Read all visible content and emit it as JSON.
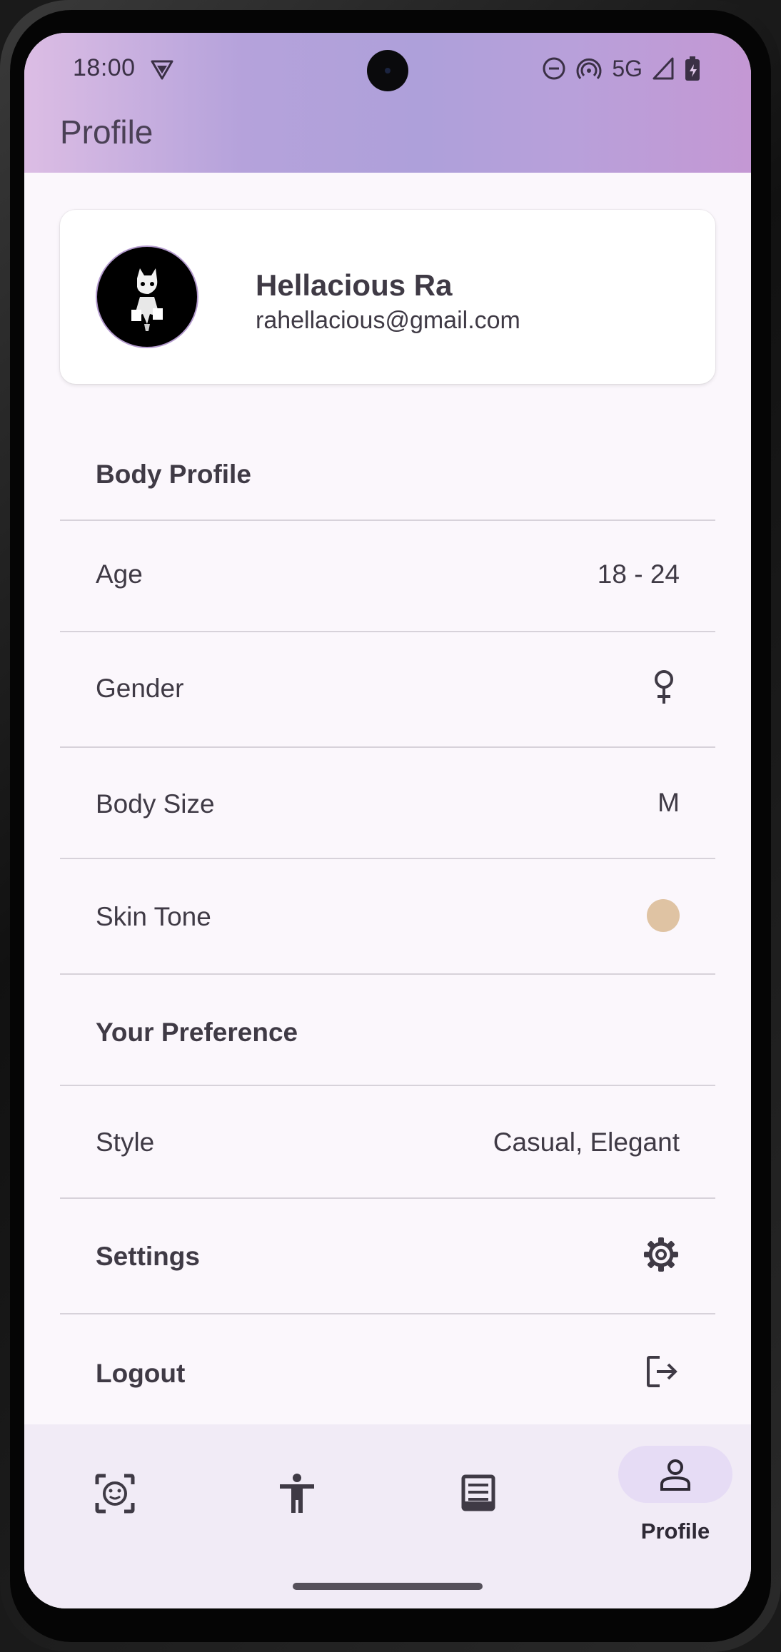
{
  "status_bar": {
    "time": "18:00",
    "network": "5G",
    "icons": [
      "vpn-icon",
      "dnd-icon",
      "hotspot-icon",
      "signal-icon",
      "battery-icon"
    ]
  },
  "header": {
    "title": "Profile"
  },
  "user": {
    "name": "Hellacious Ra",
    "email": "rahellacious@gmail.com"
  },
  "sections": {
    "body_profile": "Body Profile",
    "your_preference": "Your Preference"
  },
  "rows": {
    "age": {
      "label": "Age",
      "value": "18 - 24"
    },
    "gender": {
      "label": "Gender",
      "icon": "female-icon"
    },
    "body_size": {
      "label": "Body Size",
      "value": "M"
    },
    "skin_tone": {
      "label": "Skin Tone",
      "color": "#dfc3a3"
    },
    "style": {
      "label": "Style",
      "value": "Casual, Elegant"
    },
    "settings": {
      "label": "Settings",
      "icon": "gear-icon"
    },
    "logout": {
      "label": "Logout",
      "icon": "logout-icon"
    }
  },
  "nav": {
    "items": [
      {
        "icon": "face-scan-icon",
        "label": ""
      },
      {
        "icon": "body-icon",
        "label": ""
      },
      {
        "icon": "list-icon",
        "label": ""
      },
      {
        "icon": "person-icon",
        "label": "Profile",
        "active": true
      }
    ]
  },
  "colors": {
    "accent_pill": "#e6dcf5",
    "text": "#3f3a45"
  }
}
